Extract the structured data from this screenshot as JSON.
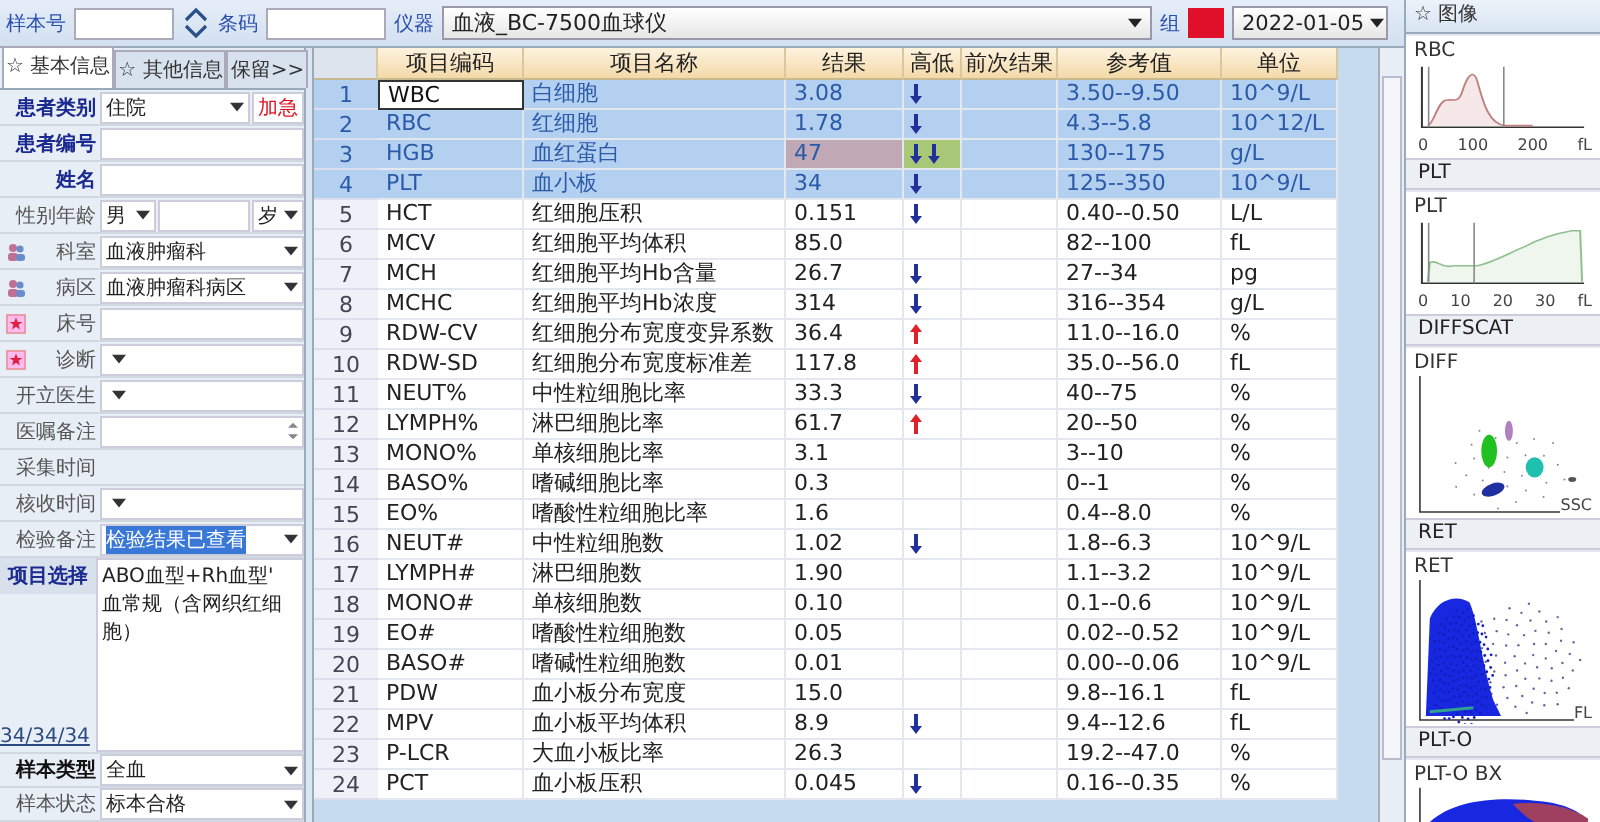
{
  "toolbar": {
    "sample_label": "样本号",
    "barcode_label": "条码",
    "instrument_label": "仪器",
    "instrument": "血液_BC-7500血球仪",
    "group_label": "组",
    "date": "2022-01-05"
  },
  "tabs": [
    {
      "label": "☆ 基本信息",
      "selected": true
    },
    {
      "label": "☆ 其他信息",
      "selected": false
    },
    {
      "label": "保留>>",
      "selected": false
    }
  ],
  "fields": [
    {
      "label": "患者类别",
      "kind": "category",
      "emphasis": true,
      "value": "住院",
      "extra": "加急"
    },
    {
      "label": "患者编号",
      "kind": "text",
      "emphasis": true
    },
    {
      "label": "姓名",
      "kind": "text",
      "emphasis": true
    },
    {
      "label": "性别年龄",
      "kind": "sex_age",
      "emphasis": false,
      "value": "男",
      "extra": "岁"
    },
    {
      "label": "科室",
      "kind": "select",
      "emphasis": false,
      "value": "血液肿瘤科"
    },
    {
      "label": "病区",
      "kind": "select",
      "emphasis": false,
      "value": "血液肿瘤科病区"
    },
    {
      "label": "床号",
      "kind": "text",
      "emphasis": false
    },
    {
      "label": "诊断",
      "kind": "select",
      "emphasis": false
    },
    {
      "label": "开立医生",
      "kind": "select",
      "emphasis": false
    },
    {
      "label": "医嘱备注",
      "kind": "spin",
      "emphasis": false
    },
    {
      "label": "采集时间",
      "kind": "blank",
      "emphasis": false
    },
    {
      "label": "核收时间",
      "kind": "select",
      "emphasis": false
    },
    {
      "label": "检验备注",
      "kind": "select",
      "emphasis": false,
      "value": "检验结果已查看",
      "highlighted": true
    }
  ],
  "project": {
    "label": "项目选择",
    "text": "ABO血型+Rh血型' 血常规（含网织红细胞）",
    "count": "34/34/34"
  },
  "bottom_fields": [
    {
      "label": "样本类型",
      "emphasis": true,
      "value": "全血"
    },
    {
      "label": "样本状态",
      "emphasis": false,
      "value": "标本合格"
    }
  ],
  "table": {
    "columns": [
      "项目编码",
      "项目名称",
      "结果",
      "高低",
      "前次结果",
      "参考值",
      "单位"
    ],
    "rows": [
      {
        "no": "1",
        "code": "WBC",
        "name": "白细胞",
        "result": "3.08",
        "low": true,
        "high": false,
        "range": "3.50--9.50",
        "unit": "10^9/L",
        "selected": true,
        "focused": true,
        "highlight": false
      },
      {
        "no": "2",
        "code": "RBC",
        "name": "红细胞",
        "result": "1.78",
        "low": true,
        "high": false,
        "range": "4.3--5.8",
        "unit": "10^12/L",
        "selected": true,
        "focused": false,
        "highlight": false
      },
      {
        "no": "3",
        "code": "HGB",
        "name": "血红蛋白",
        "result": "47",
        "low": true,
        "high": false,
        "range": "130--175",
        "unit": "g/L",
        "selected": true,
        "focused": false,
        "highlight": true
      },
      {
        "no": "4",
        "code": "PLT",
        "name": "血小板",
        "result": "34",
        "low": true,
        "high": false,
        "range": "125--350",
        "unit": "10^9/L",
        "selected": true,
        "focused": false,
        "highlight": false
      },
      {
        "no": "5",
        "code": "HCT",
        "name": "红细胞压积",
        "result": "0.151",
        "low": true,
        "high": false,
        "range": "0.40--0.50",
        "unit": "L/L",
        "selected": false,
        "focused": false,
        "highlight": false
      },
      {
        "no": "6",
        "code": "MCV",
        "name": "红细胞平均体积",
        "result": "85.0",
        "low": false,
        "high": false,
        "range": "82--100",
        "unit": "fL",
        "selected": false,
        "focused": false,
        "highlight": false
      },
      {
        "no": "7",
        "code": "MCH",
        "name": "红细胞平均Hb含量",
        "result": "26.7",
        "low": true,
        "high": false,
        "range": "27--34",
        "unit": "pg",
        "selected": false,
        "focused": false,
        "highlight": false
      },
      {
        "no": "8",
        "code": "MCHC",
        "name": "红细胞平均Hb浓度",
        "result": "314",
        "low": true,
        "high": false,
        "range": "316--354",
        "unit": "g/L",
        "selected": false,
        "focused": false,
        "highlight": false
      },
      {
        "no": "9",
        "code": "RDW-CV",
        "name": "红细胞分布宽度变异系数",
        "result": "36.4",
        "low": false,
        "high": true,
        "range": "11.0--16.0",
        "unit": "%",
        "selected": false,
        "focused": false,
        "highlight": false
      },
      {
        "no": "10",
        "code": "RDW-SD",
        "name": "红细胞分布宽度标准差",
        "result": "117.8",
        "low": false,
        "high": true,
        "range": "35.0--56.0",
        "unit": "fL",
        "selected": false,
        "focused": false,
        "highlight": false
      },
      {
        "no": "11",
        "code": "NEUT%",
        "name": "中性粒细胞比率",
        "result": "33.3",
        "low": true,
        "high": false,
        "range": "40--75",
        "unit": "%",
        "selected": false,
        "focused": false,
        "highlight": false
      },
      {
        "no": "12",
        "code": "LYMPH%",
        "name": "淋巴细胞比率",
        "result": "61.7",
        "low": false,
        "high": true,
        "range": "20--50",
        "unit": "%",
        "selected": false,
        "focused": false,
        "highlight": false
      },
      {
        "no": "13",
        "code": "MONO%",
        "name": "单核细胞比率",
        "result": "3.1",
        "low": false,
        "high": false,
        "range": "3--10",
        "unit": "%",
        "selected": false,
        "focused": false,
        "highlight": false
      },
      {
        "no": "14",
        "code": "BASO%",
        "name": "嗜碱细胞比率",
        "result": "0.3",
        "low": false,
        "high": false,
        "range": "0--1",
        "unit": "%",
        "selected": false,
        "focused": false,
        "highlight": false
      },
      {
        "no": "15",
        "code": "EO%",
        "name": "嗜酸性粒细胞比率",
        "result": "1.6",
        "low": false,
        "high": false,
        "range": "0.4--8.0",
        "unit": "%",
        "selected": false,
        "focused": false,
        "highlight": false
      },
      {
        "no": "16",
        "code": "NEUT#",
        "name": "中性粒细胞数",
        "result": "1.02",
        "low": true,
        "high": false,
        "range": "1.8--6.3",
        "unit": "10^9/L",
        "selected": false,
        "focused": false,
        "highlight": false
      },
      {
        "no": "17",
        "code": "LYMPH#",
        "name": "淋巴细胞数",
        "result": "1.90",
        "low": false,
        "high": false,
        "range": "1.1--3.2",
        "unit": "10^9/L",
        "selected": false,
        "focused": false,
        "highlight": false
      },
      {
        "no": "18",
        "code": "MONO#",
        "name": "单核细胞数",
        "result": "0.10",
        "low": false,
        "high": false,
        "range": "0.1--0.6",
        "unit": "10^9/L",
        "selected": false,
        "focused": false,
        "highlight": false
      },
      {
        "no": "19",
        "code": "EO#",
        "name": "嗜酸性粒细胞数",
        "result": "0.05",
        "low": false,
        "high": false,
        "range": "0.02--0.52",
        "unit": "10^9/L",
        "selected": false,
        "focused": false,
        "highlight": false
      },
      {
        "no": "20",
        "code": "BASO#",
        "name": "嗜碱性粒细胞数",
        "result": "0.01",
        "low": false,
        "high": false,
        "range": "0.00--0.06",
        "unit": "10^9/L",
        "selected": false,
        "focused": false,
        "highlight": false
      },
      {
        "no": "21",
        "code": "PDW",
        "name": "血小板分布宽度",
        "result": "15.0",
        "low": false,
        "high": false,
        "range": "9.8--16.1",
        "unit": "fL",
        "selected": false,
        "focused": false,
        "highlight": false
      },
      {
        "no": "22",
        "code": "MPV",
        "name": "血小板平均体积",
        "result": "8.9",
        "low": true,
        "high": false,
        "range": "9.4--12.6",
        "unit": "fL",
        "selected": false,
        "focused": false,
        "highlight": false
      },
      {
        "no": "23",
        "code": "P-LCR",
        "name": "大血小板比率",
        "result": "26.3",
        "low": false,
        "high": false,
        "range": "19.2--47.0",
        "unit": "%",
        "selected": false,
        "focused": false,
        "highlight": false
      },
      {
        "no": "24",
        "code": "PCT",
        "name": "血小板压积",
        "result": "0.045",
        "low": true,
        "high": false,
        "range": "0.16--0.35",
        "unit": "%",
        "selected": false,
        "focused": false,
        "highlight": false
      }
    ]
  },
  "image_panel": {
    "title": "☆ 图像",
    "plots": [
      {
        "kind": "histogram_rbc",
        "title": "RBC",
        "ticks": [
          "0",
          "100",
          "200",
          "fL"
        ]
      },
      {
        "header": "PLT",
        "kind": "histogram_plt",
        "title": "PLT",
        "ticks": [
          "0",
          "10",
          "20",
          "30",
          "fL"
        ]
      },
      {
        "header": "DIFFSCAT",
        "kind": "scatter_diff",
        "title": "DIFF",
        "x_label": "SSC"
      },
      {
        "header": "RET",
        "kind": "scatter_ret",
        "title": "RET",
        "x_label": "FL"
      },
      {
        "header": "PLT-O",
        "kind": "scatter_plto",
        "title": "PLT-O BX"
      }
    ]
  }
}
